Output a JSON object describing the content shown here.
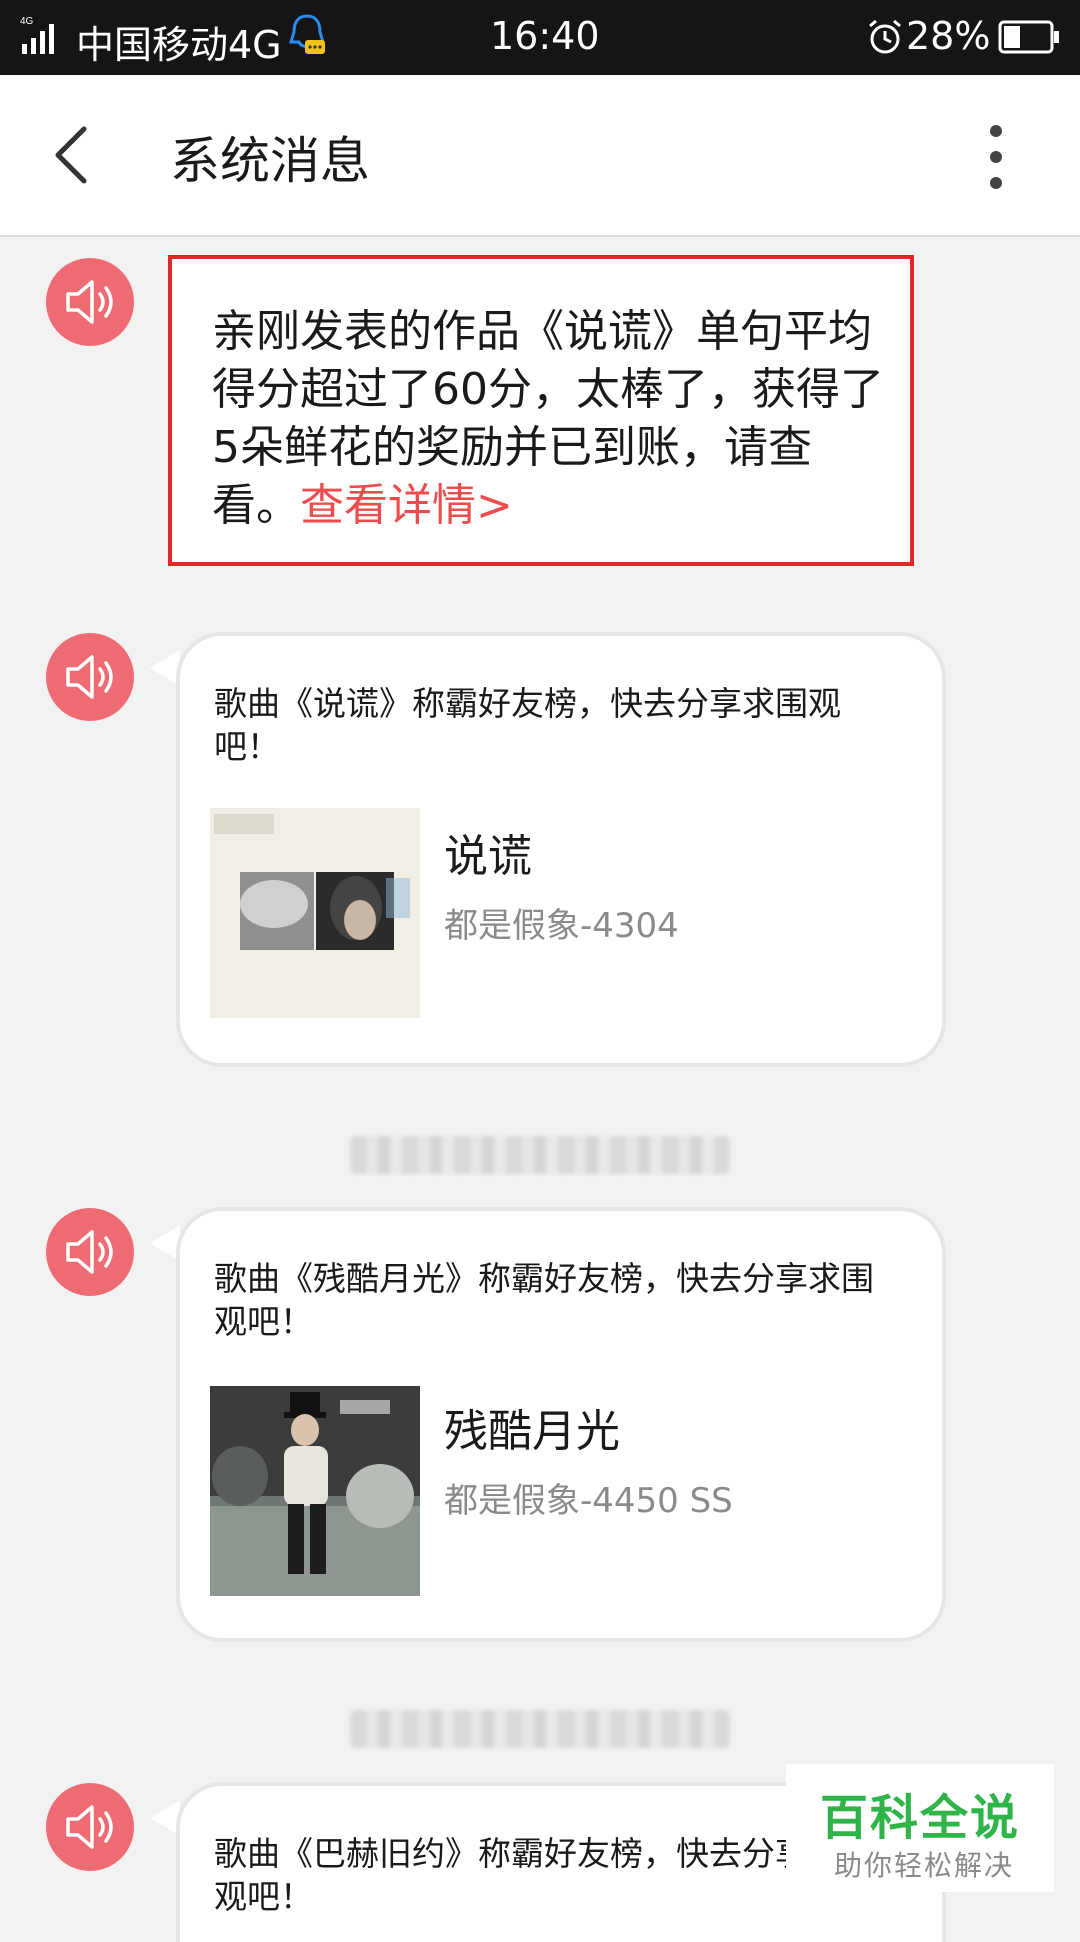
{
  "status_bar": {
    "signal_label": "4G",
    "carrier": "中国移动4G",
    "time": "16:40",
    "battery": "28%"
  },
  "header": {
    "title": "系统消息"
  },
  "messages": [
    {
      "text": "亲刚发表的作品《说谎》单句平均得分超过了60分，太棒了，获得了5朵鲜花的奖励并已到账，请查看。",
      "link": "查看详情>"
    },
    {
      "text": "歌曲《说谎》称霸好友榜，快去分享求围观吧！",
      "song_title": "说谎",
      "song_sub": "都是假象-4304"
    },
    {
      "text": "歌曲《残酷月光》称霸好友榜，快去分享求围观吧！",
      "song_title": "残酷月光",
      "song_sub": "都是假象-4450 SS"
    },
    {
      "text": "歌曲《巴赫旧约》称霸好友榜，快去分享求围观吧！"
    }
  ],
  "watermark": {
    "title": "百科全说",
    "subtitle": "助你轻松解决"
  },
  "colors": {
    "accent": "#ee6b73",
    "link": "#ee4c4c",
    "highlight_border": "#e02828",
    "watermark": "#2fb44a"
  }
}
